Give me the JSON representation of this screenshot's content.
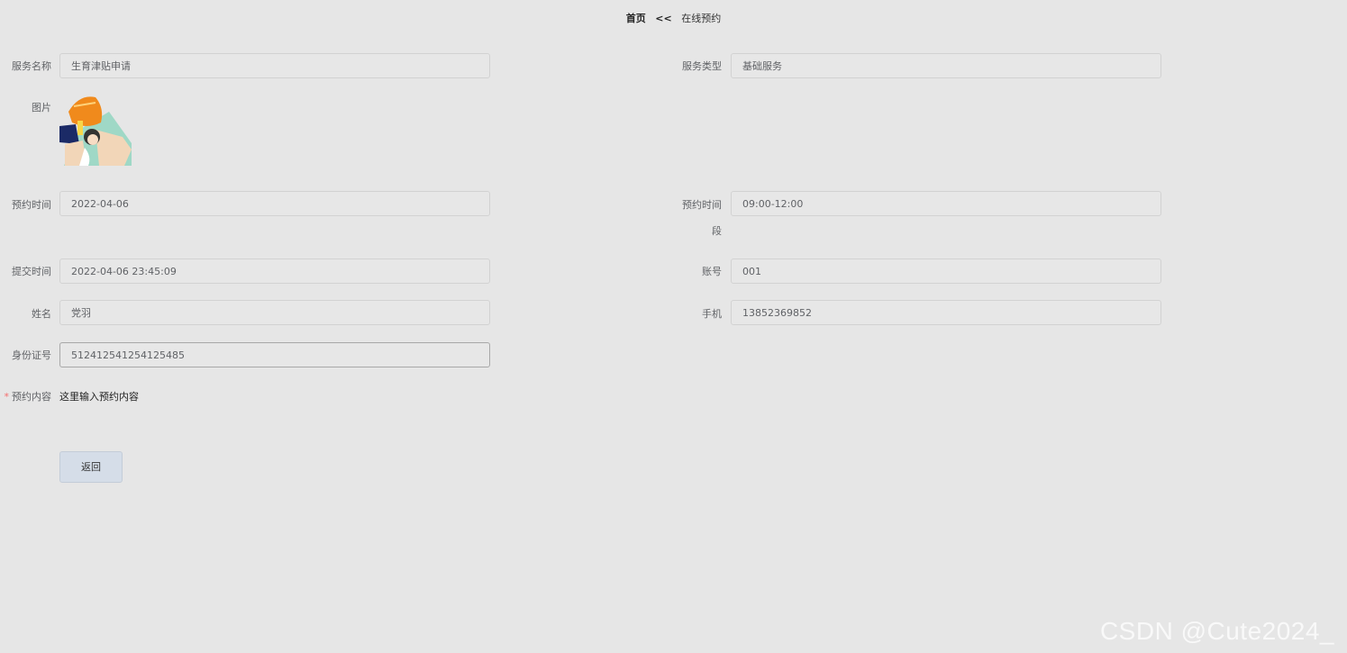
{
  "breadcrumb": {
    "home": "首页",
    "separator": "<<",
    "current": "在线预约"
  },
  "form": {
    "service_name": {
      "label": "服务名称",
      "value": "生育津贴申请"
    },
    "service_type": {
      "label": "服务类型",
      "value": "基础服务"
    },
    "picture": {
      "label": "图片"
    },
    "appointment_date": {
      "label": "预约时间",
      "value": "2022-04-06"
    },
    "appointment_slot": {
      "label_line1": "预约时间",
      "label_line2": "段",
      "value": "09:00-12:00"
    },
    "submit_time": {
      "label": "提交时间",
      "value": "2022-04-06 23:45:09"
    },
    "account": {
      "label": "账号",
      "value": "001"
    },
    "name": {
      "label": "姓名",
      "value": "党羽"
    },
    "phone": {
      "label": "手机",
      "value": "13852369852"
    },
    "id_number": {
      "label": "身份证号",
      "value": "512412541254125485"
    },
    "content": {
      "required_mark": "*",
      "label": "预约内容",
      "value": "这里输入预约内容"
    }
  },
  "actions": {
    "back_label": "返回"
  },
  "watermark": "CSDN @Cute2024_",
  "colors": {
    "background": "#e6e6e6",
    "required": "#f56c6c",
    "button_bg": "#d5dde8"
  }
}
